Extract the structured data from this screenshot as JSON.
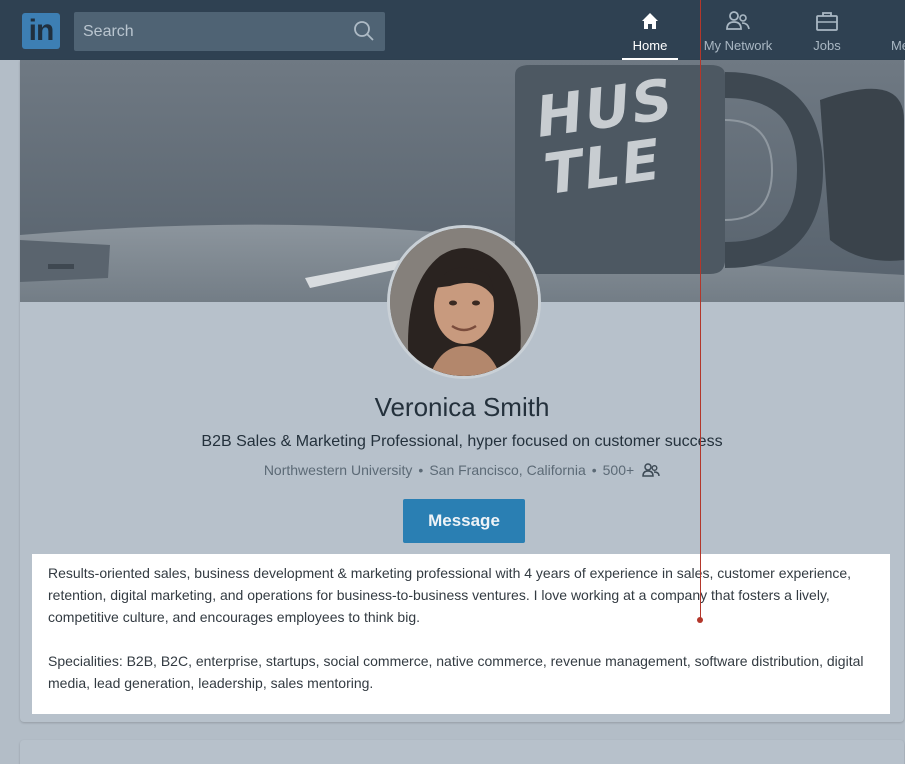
{
  "nav": {
    "logo": "in",
    "search_placeholder": "Search",
    "items": [
      {
        "label": "Home",
        "icon": "home-icon",
        "active": true
      },
      {
        "label": "My Network",
        "icon": "network-icon"
      },
      {
        "label": "Jobs",
        "icon": "briefcase-icon"
      },
      {
        "label": "Me",
        "icon": "me-icon"
      }
    ]
  },
  "profile": {
    "banner_text": "HUSTLE",
    "name": "Veronica Smith",
    "headline": "B2B Sales & Marketing Professional, hyper focused on customer success",
    "school": "Northwestern University",
    "location": "San Francisco, California",
    "connections": "500+",
    "separator": "•",
    "message_label": "Message",
    "summary": [
      "Results-oriented sales, business development & marketing professional with 4 years of experience in sales, customer experience, retention, digital marketing, and operations for business-to-business ventures. I love working at a company that fosters a lively, competitive culture, and encourages employees to think big.",
      "Specialities: B2B, B2C, enterprise, startups, social commerce, native commerce, revenue management, software distribution, digital media, lead generation, leadership, sales mentoring."
    ]
  },
  "colors": {
    "nav_bg": "#2f4152",
    "brand_blue": "#2a7fb3",
    "annotation": "#b3372b"
  }
}
